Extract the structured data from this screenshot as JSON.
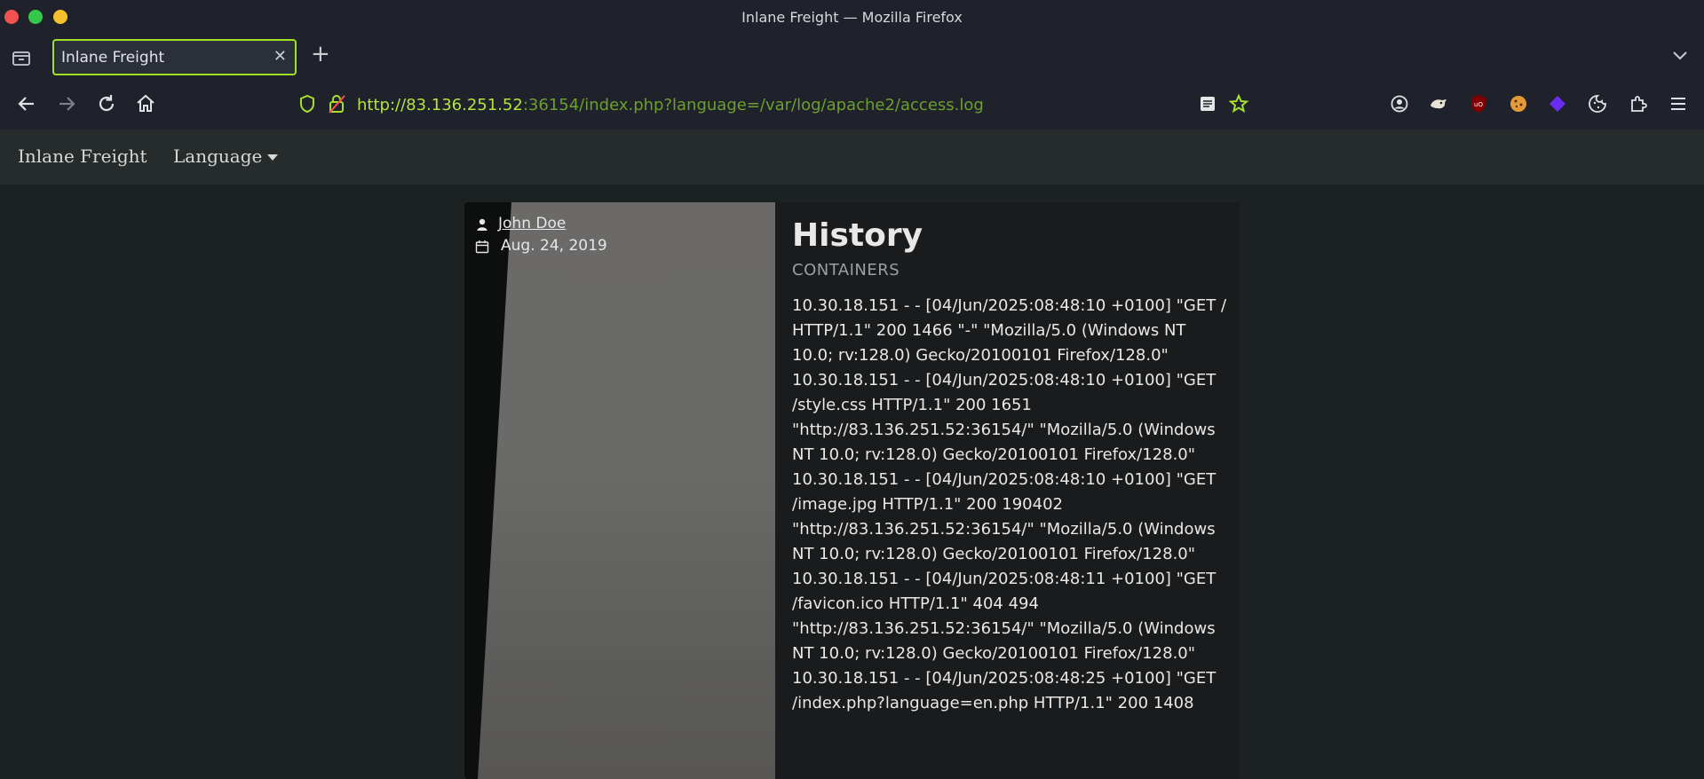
{
  "window": {
    "title": "Inlane Freight — Mozilla Firefox"
  },
  "tabs": [
    {
      "label": "Inlane Freight",
      "active": true
    }
  ],
  "toolbar": {
    "url_host": "http://83.136.251.52",
    "url_rest": ":36154/index.php?language=/var/log/apache2/access.log"
  },
  "site": {
    "brand": "Inlane Freight",
    "language_menu": "Language"
  },
  "article": {
    "author": "John Doe",
    "date": "Aug. 24, 2019",
    "title": "History",
    "subtitle": "CONTAINERS",
    "log": "10.30.18.151 - - [04/Jun/2025:08:48:10 +0100] \"GET / HTTP/1.1\" 200 1466 \"-\" \"Mozilla/5.0 (Windows NT 10.0; rv:128.0) Gecko/20100101 Firefox/128.0\" 10.30.18.151 - - [04/Jun/2025:08:48:10 +0100] \"GET /style.css HTTP/1.1\" 200 1651 \"http://83.136.251.52:36154/\" \"Mozilla/5.0 (Windows NT 10.0; rv:128.0) Gecko/20100101 Firefox/128.0\" 10.30.18.151 - - [04/Jun/2025:08:48:10 +0100] \"GET /image.jpg HTTP/1.1\" 200 190402 \"http://83.136.251.52:36154/\" \"Mozilla/5.0 (Windows NT 10.0; rv:128.0) Gecko/20100101 Firefox/128.0\" 10.30.18.151 - - [04/Jun/2025:08:48:11 +0100] \"GET /favicon.ico HTTP/1.1\" 404 494 \"http://83.136.251.52:36154/\" \"Mozilla/5.0 (Windows NT 10.0; rv:128.0) Gecko/20100101 Firefox/128.0\" 10.30.18.151 - - [04/Jun/2025:08:48:25 +0100] \"GET /index.php?language=en.php HTTP/1.1\" 200 1408"
  },
  "colors": {
    "accent": "#9ee221",
    "url_host": "#b7e33b",
    "url_path": "#6c9f2c",
    "toolbar_bg": "#1f222b",
    "page_bg": "#1c2121"
  },
  "icons": {
    "tab_list": "tab-list-icon",
    "back": "back-arrow-icon",
    "forward": "forward-arrow-icon",
    "reload": "reload-icon",
    "home": "home-icon",
    "shield": "shield-icon",
    "lock": "insecure-lock-icon",
    "reader": "reader-view-icon",
    "bookmark": "bookmark-star-icon",
    "extensions": [
      "account-icon",
      "extension-badger-icon",
      "ublock-icon",
      "cookie-extension-icon",
      "gem-extension-icon",
      "cookie-icon",
      "extensions-puzzle-icon"
    ],
    "menu": "hamburger-menu-icon",
    "author": "user-icon",
    "date": "calendar-icon"
  }
}
